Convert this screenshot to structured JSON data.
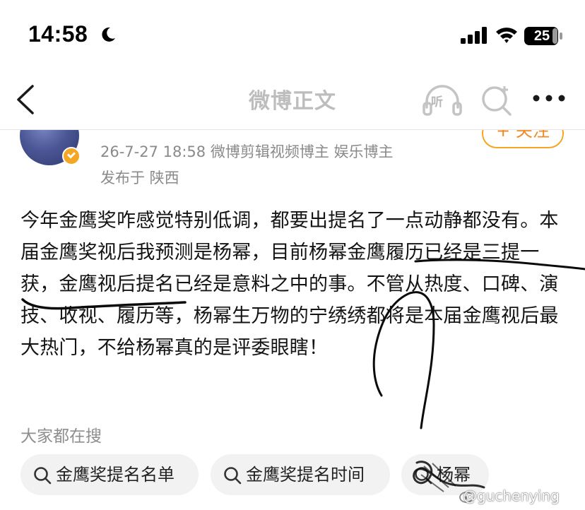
{
  "status_bar": {
    "time": "14:58",
    "battery": "25",
    "icons": [
      "moon-icon",
      "signal-icon",
      "wifi-icon",
      "battery-icon"
    ]
  },
  "nav": {
    "title": "微博正文",
    "listen_label": "听",
    "icons": [
      "back-icon",
      "listen-icon",
      "search-plus-icon",
      "more-icon"
    ]
  },
  "author": {
    "follow_label": "+ 关注",
    "meta": "26-7-27 18:58  微博剪辑视频博主 娱乐博主",
    "location": "发布于 陕西",
    "verify_color": "#f5a623"
  },
  "post": {
    "text": "今年金鹰奖咋感觉特别低调，都要出提名了一点动静都没有。本届金鹰奖视后我预测是杨幂，目前杨幂金鹰履历已经是三提一获，金鹰视后提名已经是意料之中的事。不管从热度、口碑、演技、收视、履历等，杨幂生万物的宁绣绣都将是本届金鹰视后最大热门，不给杨幂真的是评委眼瞎！"
  },
  "hot_search": {
    "label": "大家都在搜",
    "chips": [
      "金鹰奖提名名单",
      "金鹰奖提名时间",
      "杨幂"
    ]
  },
  "watermark": "@guchenying",
  "colors": {
    "accent": "#f5a623",
    "muted": "#8a8a8a",
    "nav_title": "#bdbdbd"
  }
}
